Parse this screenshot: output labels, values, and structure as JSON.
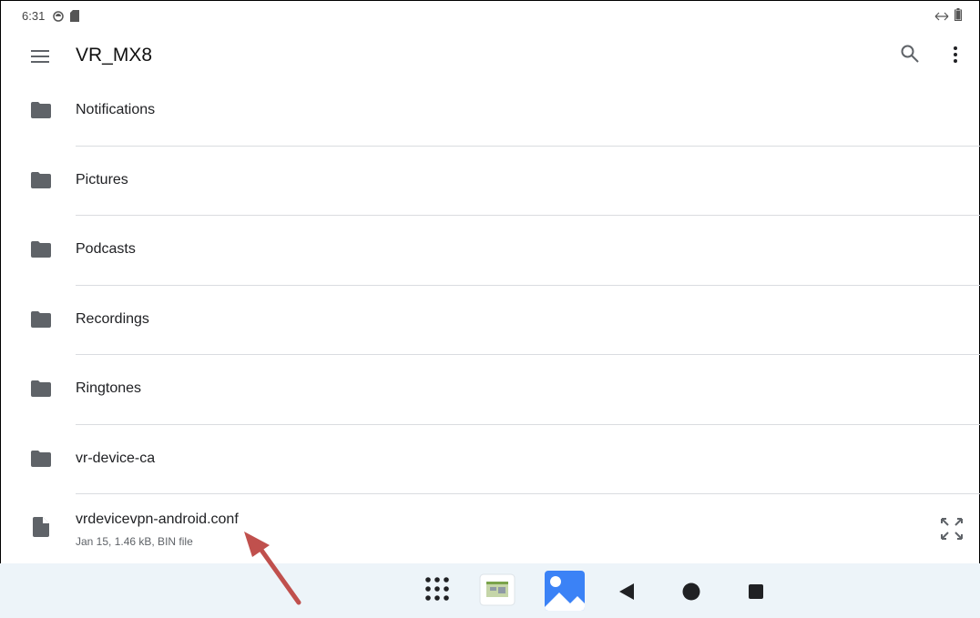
{
  "status": {
    "time": "6:31"
  },
  "app_bar": {
    "title": "VR_MX8"
  },
  "folders": [
    {
      "label": "Notifications"
    },
    {
      "label": "Pictures"
    },
    {
      "label": "Podcasts"
    },
    {
      "label": "Recordings"
    },
    {
      "label": "Ringtones"
    },
    {
      "label": "vr-device-ca"
    }
  ],
  "file": {
    "name": "vrdevicevpn-android.conf",
    "meta": "Jan 15, 1.46 kB, BIN file"
  },
  "colors": {
    "accent_arrow": "#c0504d",
    "nav_bg": "#edf4f9",
    "icon": "#5f6368"
  }
}
